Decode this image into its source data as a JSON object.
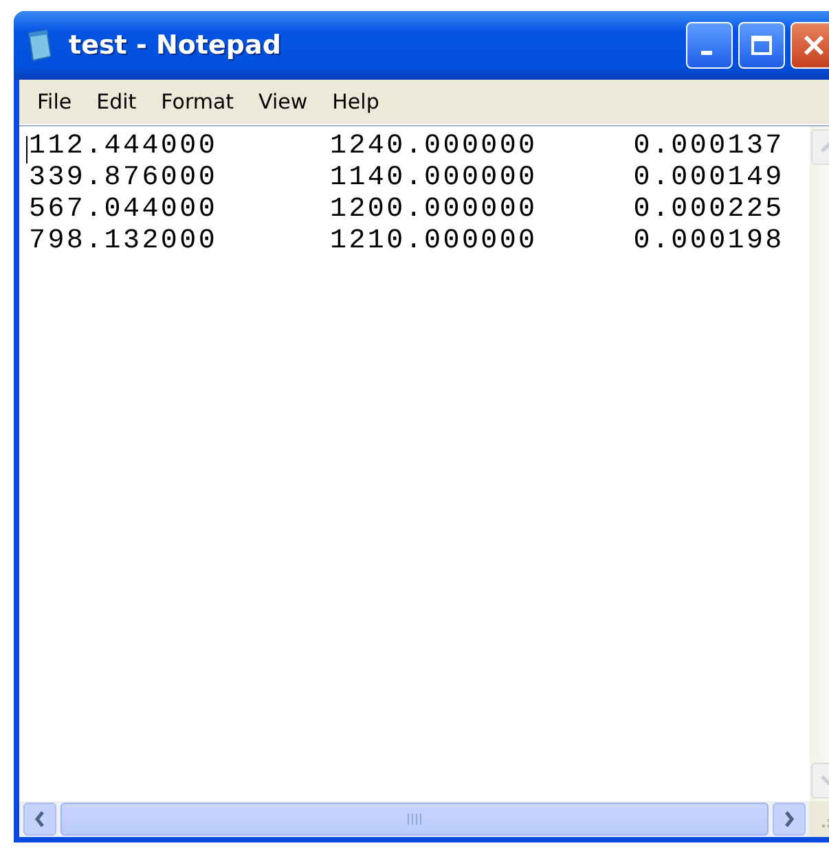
{
  "window": {
    "title": "test - Notepad"
  },
  "menu": [
    "File",
    "Edit",
    "Format",
    "View",
    "Help"
  ],
  "rows": [
    [
      "112.444000",
      "1240.000000",
      "0.000137"
    ],
    [
      "339.876000",
      "1140.000000",
      "0.000149"
    ],
    [
      "567.044000",
      "1200.000000",
      "0.000225"
    ],
    [
      "798.132000",
      "1210.000000",
      "0.000198"
    ]
  ]
}
